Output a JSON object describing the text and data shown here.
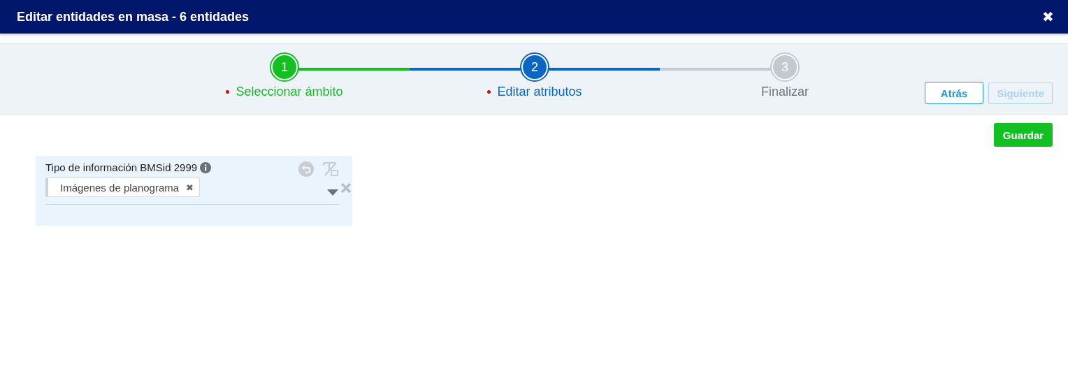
{
  "window": {
    "title": "Editar entidades en masa - 6 entidades",
    "close": "✖"
  },
  "steps": [
    {
      "number": "1",
      "label": "Seleccionar ámbito",
      "done": true,
      "selected": false,
      "marked": true
    },
    {
      "number": "2",
      "label": "Editar atributos",
      "done": false,
      "selected": true,
      "marked": true
    },
    {
      "number": "3",
      "label": "Finalizar",
      "done": false,
      "selected": false,
      "marked": false
    }
  ],
  "nav_buttons": [
    {
      "label": "Atrás",
      "disabled": false
    },
    {
      "label": "Siguiente",
      "disabled": true
    }
  ],
  "save_button": "Guardar",
  "attribute": {
    "label": "Tipo de información BMSid 2999",
    "values": [
      {
        "text": "Imágenes de planograma",
        "remove": "✖"
      }
    ]
  }
}
